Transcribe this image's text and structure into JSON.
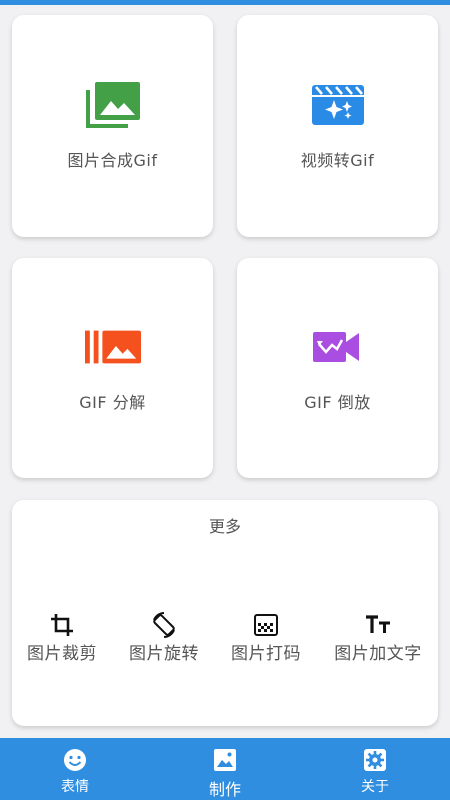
{
  "cards": [
    {
      "label": "图片合成Gif",
      "icon": "photo-library-icon",
      "color": "#43a047"
    },
    {
      "label": "视频转Gif",
      "icon": "movie-sparkle-icon",
      "color": "#2a8be6"
    },
    {
      "label": "GIF 分解",
      "icon": "burst-image-icon",
      "color": "#f4511e"
    },
    {
      "label": "GIF 倒放",
      "icon": "video-reverse-icon",
      "color": "#a94ee0"
    }
  ],
  "more": {
    "title": "更多",
    "tools": [
      {
        "label": "图片裁剪",
        "icon": "crop-icon"
      },
      {
        "label": "图片旋转",
        "icon": "rotate-icon"
      },
      {
        "label": "图片打码",
        "icon": "mosaic-icon"
      },
      {
        "label": "图片加文字",
        "icon": "text-fields-icon"
      }
    ]
  },
  "tabs": [
    {
      "label": "表情",
      "icon": "smiley-icon"
    },
    {
      "label": "制作",
      "icon": "image-icon"
    },
    {
      "label": "关于",
      "icon": "gear-icon"
    }
  ],
  "colors": {
    "primary": "#2f8ee0",
    "background": "#f1f1f3",
    "card": "#ffffff",
    "text": "#555555"
  }
}
